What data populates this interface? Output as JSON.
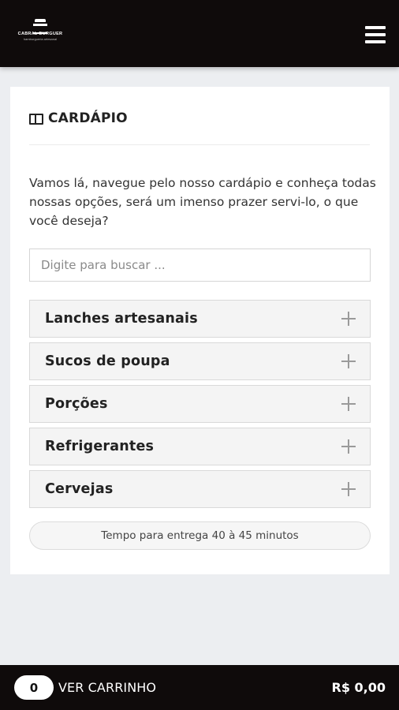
{
  "header": {
    "logo_name": "CABRAL BURGUER",
    "logo_tagline": "hamburgueria artesanal"
  },
  "menu_section": {
    "title": "CARDÁPIO",
    "intro": "Vamos lá, navegue pelo nosso cardápio e conheça todas nossas opções, será um imenso prazer servi-lo, o que você deseja?",
    "search_placeholder": "Digite para buscar ...",
    "categories": [
      {
        "label": "Lanches artesanais"
      },
      {
        "label": "Sucos de poupa"
      },
      {
        "label": "Porções"
      },
      {
        "label": "Refrigerantes"
      },
      {
        "label": "Cervejas"
      }
    ],
    "delivery_time": "Tempo para entrega 40 à 45 minutos"
  },
  "cart": {
    "count": "0",
    "label": "VER CARRINHO",
    "total": "R$ 0,00"
  },
  "colors": {
    "bar_background": "#0f0b0b",
    "page_background": "#eceef1",
    "card_background": "#ffffff",
    "item_background": "#f4f4f4"
  },
  "icons": {
    "menu": "hamburger-menu-icon",
    "section": "book-icon",
    "expand": "plus-icon"
  }
}
